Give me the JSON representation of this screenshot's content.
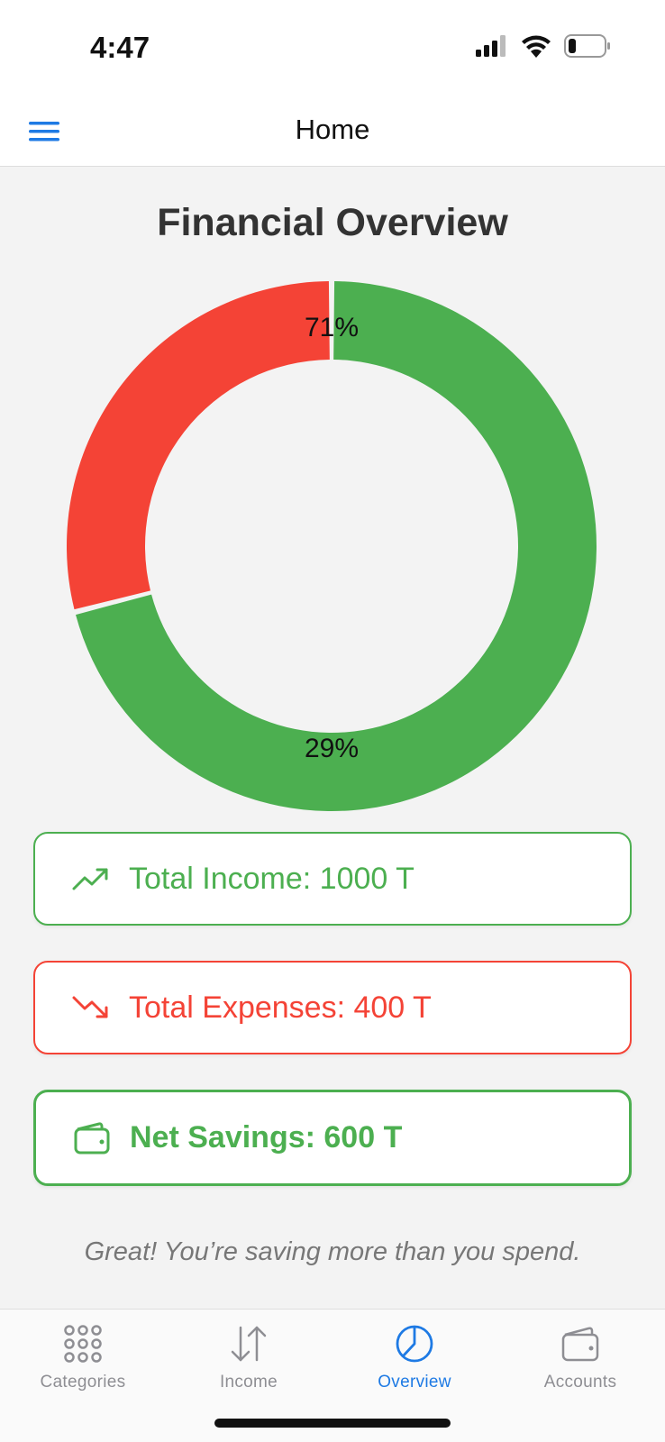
{
  "status_bar": {
    "time": "4:47"
  },
  "nav": {
    "title": "Home",
    "menu_icon": "hamburger-menu-icon"
  },
  "overview": {
    "title": "Financial Overview",
    "colors": {
      "income": "#4caf50",
      "expenses": "#f44336"
    }
  },
  "chart_data": {
    "type": "pie",
    "donut": true,
    "slices": [
      {
        "value": 71,
        "label": "71%",
        "color": "#4caf50"
      },
      {
        "value": 29,
        "label": "29%",
        "color": "#f44336"
      }
    ]
  },
  "summary": {
    "income": {
      "text": "Total Income: 1000 T",
      "icon": "trending-up-icon"
    },
    "expenses": {
      "text": "Total Expenses: 400 T",
      "icon": "trending-down-icon"
    },
    "savings": {
      "text": "Net Savings: 600 T",
      "icon": "wallet-icon"
    }
  },
  "message": "Great! You’re saving more than you spend.",
  "tabs": [
    {
      "label": "Categories",
      "icon": "grid-icon",
      "active": false
    },
    {
      "label": "Income",
      "icon": "arrows-up-down-icon",
      "active": false
    },
    {
      "label": "Overview",
      "icon": "pie-chart-icon",
      "active": true
    },
    {
      "label": "Accounts",
      "icon": "wallet-icon",
      "active": false
    }
  ],
  "tab_colors": {
    "active": "#1e7ae4",
    "inactive": "#8e8e93"
  }
}
